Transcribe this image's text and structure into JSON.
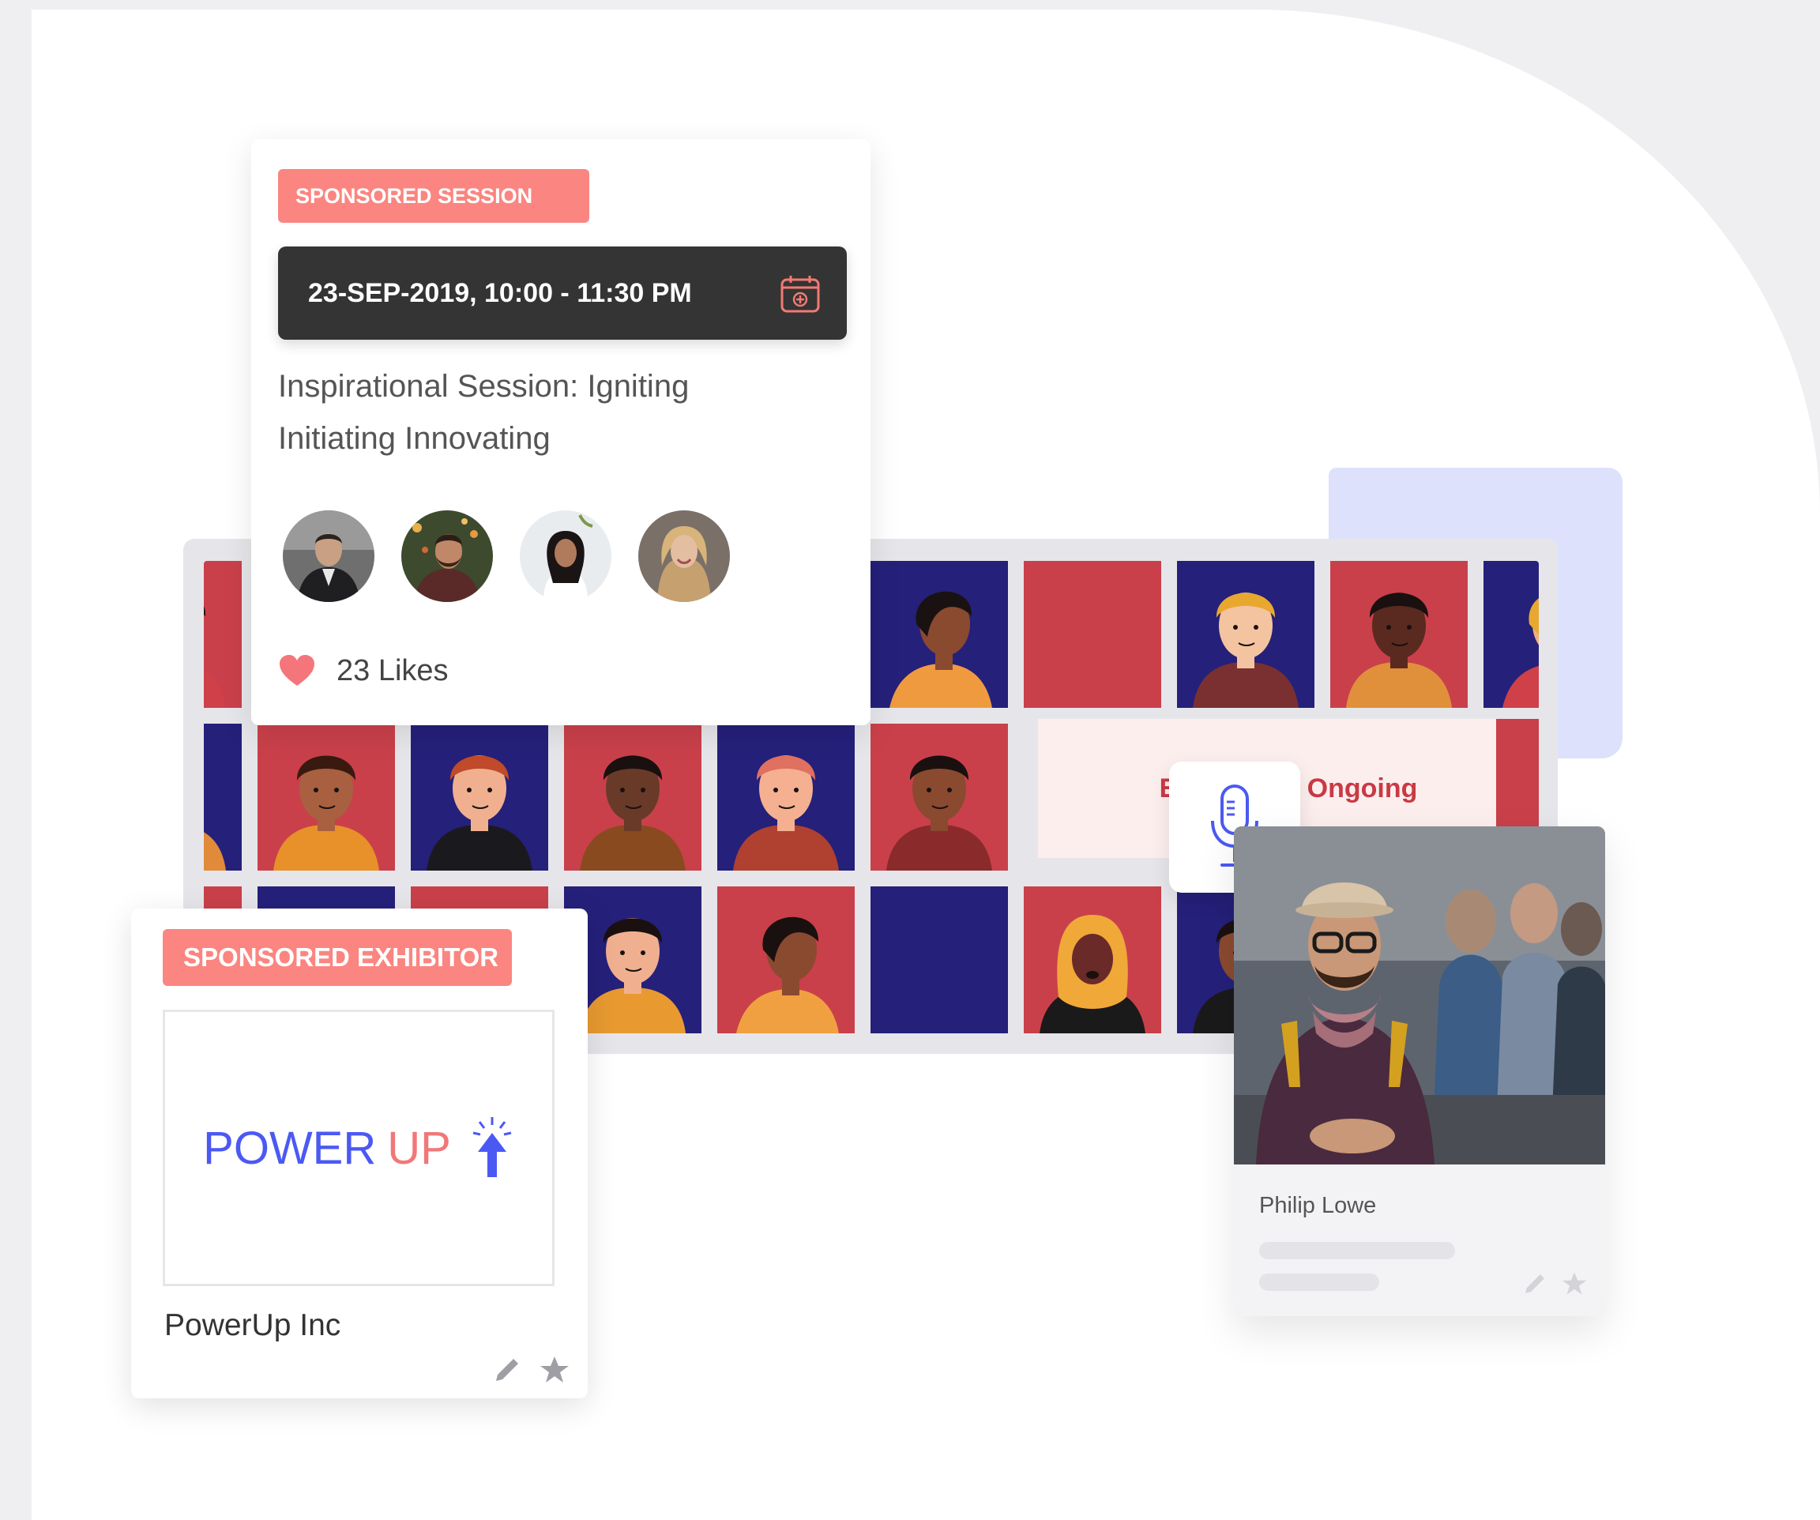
{
  "session_card": {
    "tag": "SPONSORED SESSION",
    "datetime": "23-SEP-2019, 10:00 - 11:30 PM",
    "calendar_icon": "calendar-add-icon",
    "title": "Inspirational Session: Igniting Initiating Innovating",
    "likes": "23 Likes",
    "heart_icon": "heart-icon"
  },
  "grid": {
    "banner": "Enrollment Ongoing"
  },
  "exhibitor_card": {
    "tag": "SPONSORED EXHIBITOR",
    "logo_word1": "POWER",
    "logo_word2": "UP",
    "name": "PowerUp Inc"
  },
  "person_card": {
    "name": "Philip Lowe"
  },
  "colors": {
    "tag": "#fb8580",
    "red_tile": "#c9404a",
    "blue_tile": "#25207a",
    "brand_blue": "#4b59f3",
    "dark_bar": "#343434"
  }
}
